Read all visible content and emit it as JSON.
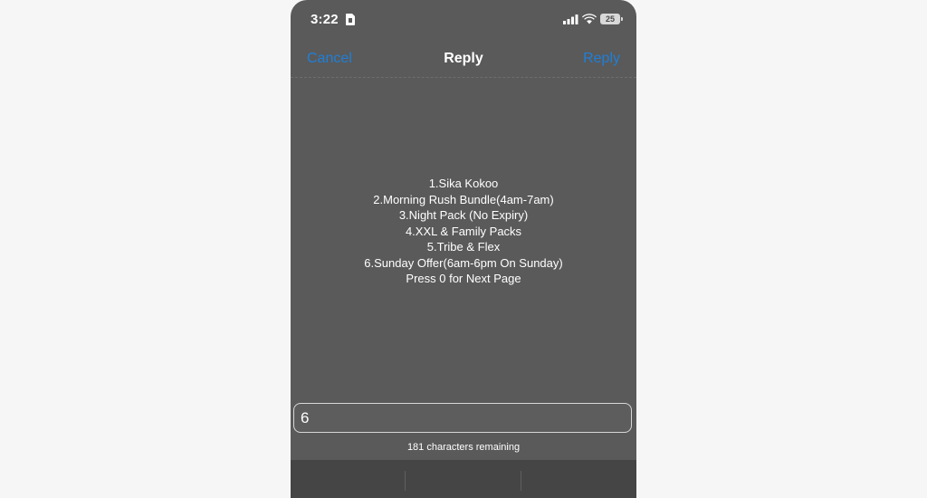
{
  "status_bar": {
    "time": "3:22",
    "battery": "25",
    "icons": [
      "sim-card-icon",
      "cellular-signal-icon",
      "wifi-icon",
      "battery-icon"
    ]
  },
  "nav": {
    "cancel_label": "Cancel",
    "title": "Reply",
    "reply_label": "Reply"
  },
  "message": {
    "lines": [
      "1.Sika Kokoo",
      "2.Morning Rush Bundle(4am-7am)",
      "3.Night Pack (No Expiry)",
      "4.XXL & Family Packs",
      "5.Tribe & Flex",
      "6.Sunday Offer(6am-6pm On Sunday)",
      "Press 0 for Next Page"
    ]
  },
  "reply_input": {
    "value": "6"
  },
  "remaining_text": "181 characters remaining",
  "colors": {
    "background": "#5a5a5a",
    "accent": "#1e7fd8",
    "page": "#f6f6f6"
  }
}
